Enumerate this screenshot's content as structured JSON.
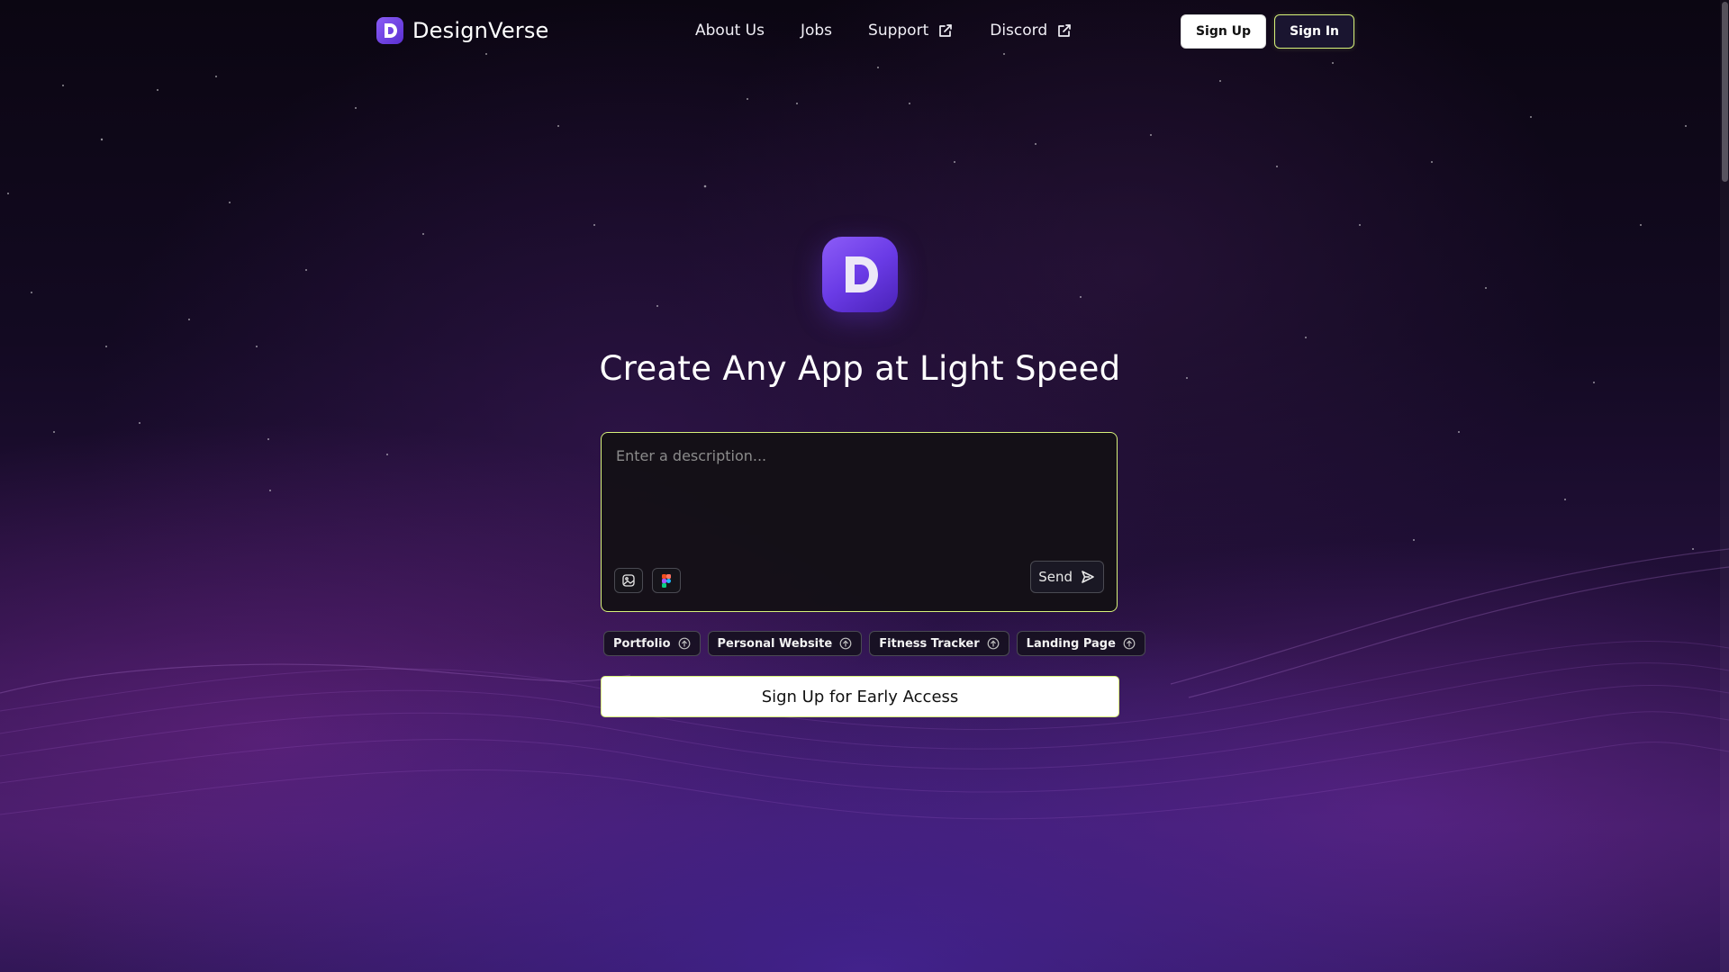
{
  "brand": {
    "name": "DesignVerse",
    "logo_letter": "D",
    "logo_icon": "d-logo-icon"
  },
  "nav": {
    "items": [
      {
        "label": "About Us",
        "external": false
      },
      {
        "label": "Jobs",
        "external": false
      },
      {
        "label": "Support",
        "external": true,
        "icon": "external-link-icon"
      },
      {
        "label": "Discord",
        "external": true,
        "icon": "external-link-icon"
      }
    ]
  },
  "auth": {
    "signup_label": "Sign Up",
    "signin_label": "Sign In"
  },
  "hero": {
    "logo_letter": "D",
    "title": "Create Any App at Light Speed"
  },
  "prompt": {
    "placeholder": "Enter a description...",
    "value": "",
    "tools": [
      {
        "icon": "image-upload-icon"
      },
      {
        "icon": "figma-icon"
      }
    ],
    "send_label": "Send",
    "send_icon": "send-icon"
  },
  "suggestions": [
    {
      "label": "Portfolio",
      "icon": "arrow-up-circle-icon"
    },
    {
      "label": "Personal Website",
      "icon": "arrow-up-circle-icon"
    },
    {
      "label": "Fitness Tracker",
      "icon": "arrow-up-circle-icon"
    },
    {
      "label": "Landing Page",
      "icon": "arrow-up-circle-icon"
    }
  ],
  "cta": {
    "label": "Sign Up for Early Access"
  },
  "colors": {
    "accent_border": "#d7f27a",
    "brand_purple": "#7a4cf0",
    "background": "#130a22"
  }
}
